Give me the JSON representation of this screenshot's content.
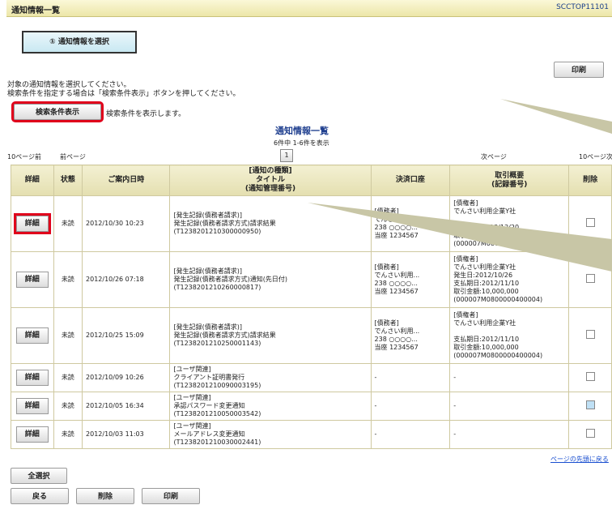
{
  "window": {
    "title": "通知情報一覧",
    "screen_code": "SCCTOP11101"
  },
  "step": {
    "label": "① 通知情報を選択"
  },
  "top_print_button": "印刷",
  "instructions": [
    "対象の通知情報を選択してください。",
    "検索条件を指定する場合は「検索条件表示」ボタンを押してください。"
  ],
  "search": {
    "button": "検索条件表示",
    "hint": "検索条件を表示します。"
  },
  "list": {
    "heading": "通知情報一覧",
    "count": "6件中 1-6件を表示",
    "pager": {
      "prev10": "10ページ前",
      "prev": "前ページ",
      "current": "1",
      "next": "次ページ",
      "next10": "10ページ次"
    },
    "columns": [
      "詳細",
      "状態",
      "ご案内日時",
      "[通知の種類]\nタイトル\n(通知管理番号)",
      "決済口座",
      "取引概要\n(記録番号)",
      "削除"
    ],
    "rows": [
      {
        "detail": "詳細",
        "status": "未読",
        "datetime": "2012/10/30 10:23",
        "title": "[発生記録(債務者請求)]\n発生記録(債務者請求方式)請求結果\n(T1238201210300000950)",
        "account": "[債務者]\nでんさい利用...\n238 ○○○○...\n当座 1234567",
        "summary": "[債権者]\nでんさい利用企業Y社\n\n支払期日:2012/12/20\n取引金額:10,000,000\n(000007M0800000400004)",
        "checked": false
      },
      {
        "detail": "詳細",
        "status": "未読",
        "datetime": "2012/10/26 07:18",
        "title": "[発生記録(債務者請求)]\n発生記録(債務者請求方式)通知(先日付)\n(T1238201210260000817)",
        "account": "[債務者]\nでんさい利用...\n238 ○○○○...\n当座 1234567",
        "summary": "[債権者]\nでんさい利用企業Y社\n発生日:2012/10/26\n支払期日:2012/11/10\n取引金額:10,000,000\n(000007M0800000400004)",
        "checked": false
      },
      {
        "detail": "詳細",
        "status": "未読",
        "datetime": "2012/10/25 15:09",
        "title": "[発生記録(債務者請求)]\n発生記録(債務者請求方式)請求結果\n(T1238201210250001143)",
        "account": "[債務者]\nでんさい利用...\n238 ○○○○...\n当座 1234567",
        "summary": "[債権者]\nでんさい利用企業Y社\n\n支払期日:2012/11/10\n取引金額:10,000,000\n(000007M0800000400004)",
        "checked": false
      },
      {
        "detail": "詳細",
        "status": "未読",
        "datetime": "2012/10/09 10:26",
        "title": "[ユーザ関連]\nクライアント証明書発行\n(T1238201210090003195)",
        "account": "-",
        "summary": "-",
        "checked": false
      },
      {
        "detail": "詳細",
        "status": "未読",
        "datetime": "2012/10/05 16:34",
        "title": "[ユーザ関連]\n承認パスワード変更通知\n(T1238201210050003542)",
        "account": "-",
        "summary": "-",
        "checked": true
      },
      {
        "detail": "詳細",
        "status": "未読",
        "datetime": "2012/10/03 11:03",
        "title": "[ユーザ関連]\nメールアドレス変更通知\n(T1238201210030002441)",
        "account": "-",
        "summary": "-",
        "checked": false
      }
    ],
    "page_top_link": "ページの先頭に戻る"
  },
  "bottom": {
    "select_all": "全選択",
    "back": "戻る",
    "delete": "削除",
    "print": "印刷"
  },
  "colors": {
    "title_bar": "#ece6a8",
    "highlight": "#e0001b",
    "callout": "#c8c6a6"
  }
}
